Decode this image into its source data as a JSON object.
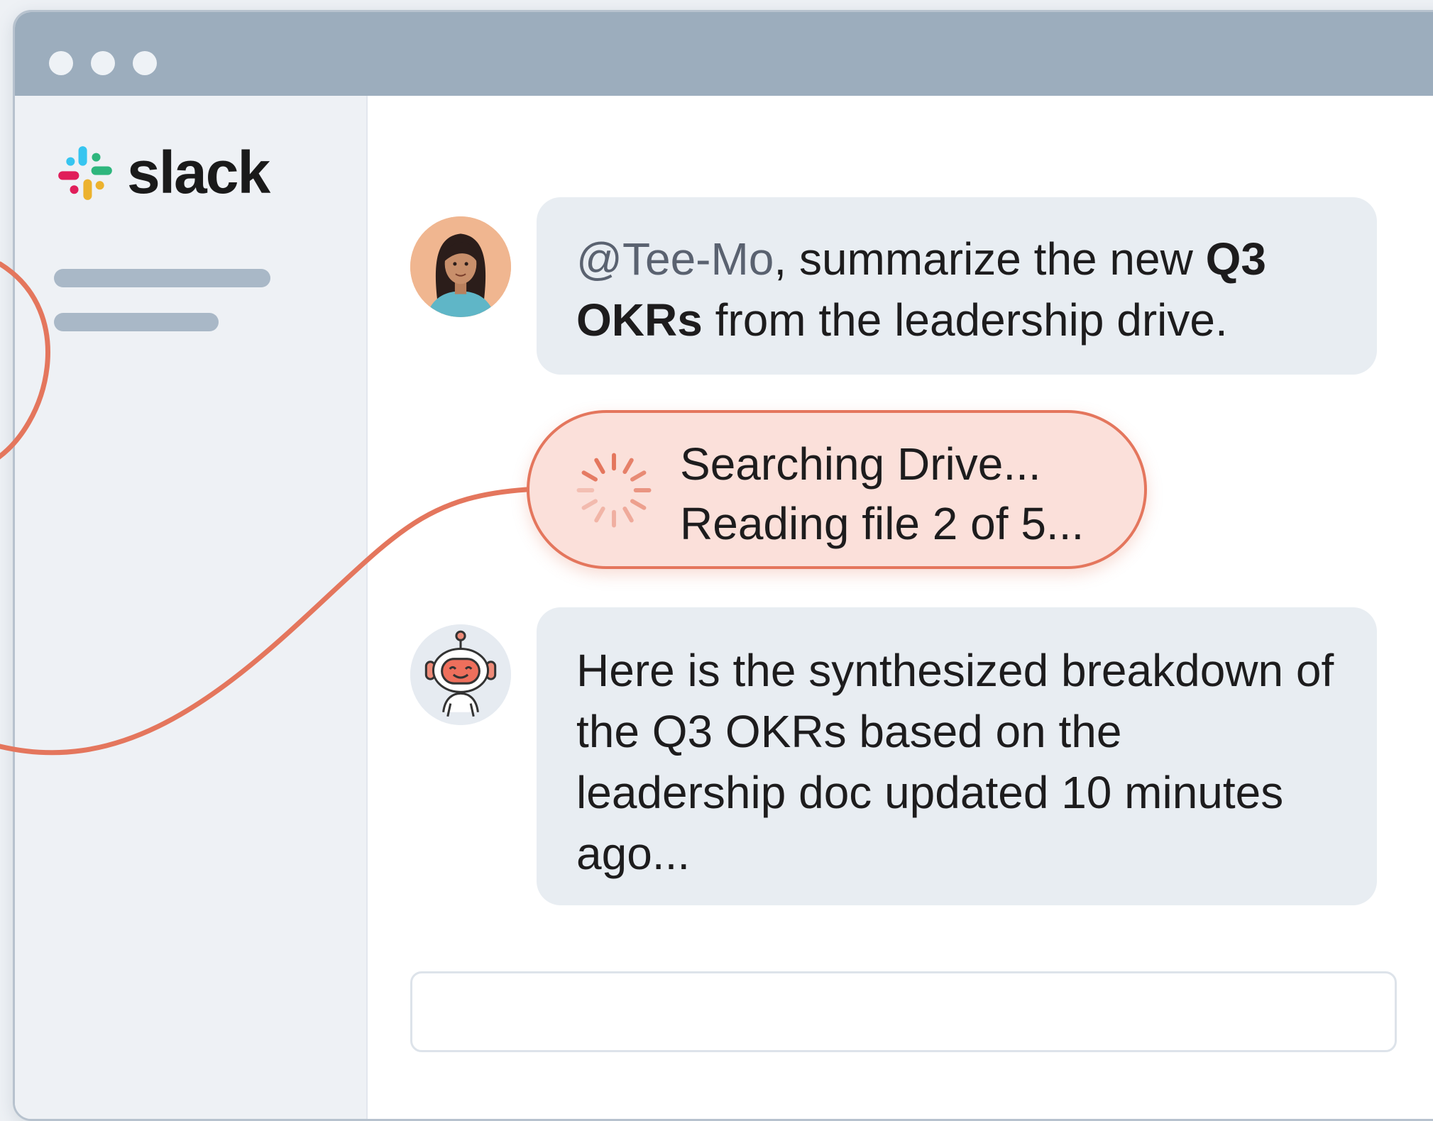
{
  "app": {
    "logo_text": "slack",
    "accent_color": "#e4765d",
    "titlebar_color": "#9cadbd"
  },
  "messages": [
    {
      "author": "user",
      "mention": "@Tee-Mo",
      "text_after_mention": ", summarize the new ",
      "bold_text": "Q3 OKRs",
      "text_end": " from the leadership drive."
    },
    {
      "author": "bot",
      "text": "Here is the synthesized breakdown of the Q3 OKRs based on the leadership doc updated 10 minutes ago..."
    }
  ],
  "status": {
    "line1": "Searching Drive...",
    "line2": "Reading file 2 of 5..."
  },
  "icons": {
    "logo": "slack-logo-icon",
    "spinner": "loading-spinner-icon",
    "user_avatar": "user-avatar",
    "bot_avatar": "robot-avatar"
  }
}
